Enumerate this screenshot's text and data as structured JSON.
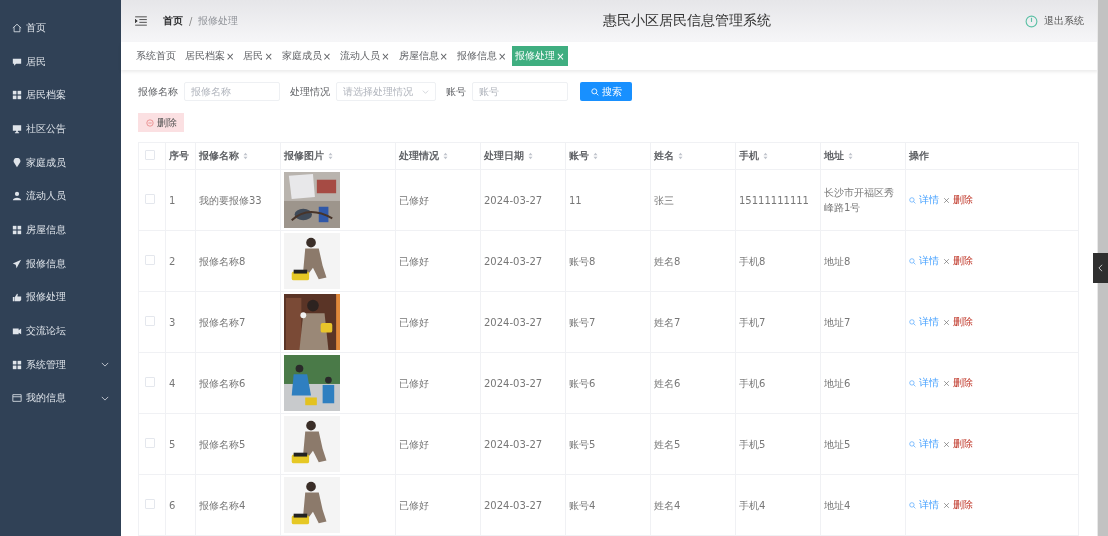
{
  "sidebar": {
    "items": [
      {
        "label": "首页",
        "expandable": false
      },
      {
        "label": "居民",
        "expandable": false
      },
      {
        "label": "居民档案",
        "expandable": false
      },
      {
        "label": "社区公告",
        "expandable": false
      },
      {
        "label": "家庭成员",
        "expandable": false
      },
      {
        "label": "流动人员",
        "expandable": false
      },
      {
        "label": "房屋信息",
        "expandable": false
      },
      {
        "label": "报修信息",
        "expandable": false
      },
      {
        "label": "报修处理",
        "expandable": false
      },
      {
        "label": "交流论坛",
        "expandable": false
      },
      {
        "label": "系统管理",
        "expandable": true
      },
      {
        "label": "我的信息",
        "expandable": true
      }
    ]
  },
  "header": {
    "breadcrumb": [
      "首页",
      "报修处理"
    ],
    "breadcrumb_separator": "/",
    "title": "惠民小区居民信息管理系统",
    "logout": "退出系统"
  },
  "tabs": [
    {
      "label": "系统首页",
      "closable": false,
      "selected": false
    },
    {
      "label": "居民档案",
      "closable": true,
      "selected": false
    },
    {
      "label": "居民",
      "closable": true,
      "selected": false
    },
    {
      "label": "家庭成员",
      "closable": true,
      "selected": false
    },
    {
      "label": "流动人员",
      "closable": true,
      "selected": false
    },
    {
      "label": "房屋信息",
      "closable": true,
      "selected": false
    },
    {
      "label": "报修信息",
      "closable": true,
      "selected": false
    },
    {
      "label": "报修处理",
      "closable": true,
      "selected": true
    }
  ],
  "close_mark": "×",
  "search": {
    "fields": [
      {
        "label": "报修名称",
        "placeholder": "报修名称",
        "kind": "text"
      },
      {
        "label": "处理情况",
        "placeholder": "请选择处理情况",
        "kind": "select"
      },
      {
        "label": "账号",
        "placeholder": "账号",
        "kind": "text"
      }
    ],
    "button": "搜索"
  },
  "delete_button": "删除",
  "table": {
    "columns": [
      {
        "label": "序号",
        "sortable": false
      },
      {
        "label": "报修名称",
        "sortable": true
      },
      {
        "label": "报修图片",
        "sortable": true
      },
      {
        "label": "处理情况",
        "sortable": true
      },
      {
        "label": "处理日期",
        "sortable": true
      },
      {
        "label": "账号",
        "sortable": true
      },
      {
        "label": "姓名",
        "sortable": true
      },
      {
        "label": "手机",
        "sortable": true
      },
      {
        "label": "地址",
        "sortable": true
      },
      {
        "label": "操作",
        "sortable": false
      }
    ],
    "select_all_checked": false,
    "rows": [
      {
        "checked": false,
        "before": [
          "1",
          "我的要报修33"
        ],
        "after": [
          "已修好",
          "2024-03-27",
          "11",
          "张三",
          "15111111111",
          "长沙市开福区秀峰路1号"
        ],
        "actions": [
          "详情",
          "删除"
        ]
      },
      {
        "checked": false,
        "before": [
          "2",
          "报修名称8"
        ],
        "after": [
          "已修好",
          "2024-03-27",
          "账号8",
          "姓名8",
          "手机8",
          "地址8"
        ],
        "actions": [
          "详情",
          "删除"
        ]
      },
      {
        "checked": false,
        "before": [
          "3",
          "报修名称7"
        ],
        "after": [
          "已修好",
          "2024-03-27",
          "账号7",
          "姓名7",
          "手机7",
          "地址7"
        ],
        "actions": [
          "详情",
          "删除"
        ]
      },
      {
        "checked": false,
        "before": [
          "4",
          "报修名称6"
        ],
        "after": [
          "已修好",
          "2024-03-27",
          "账号6",
          "姓名6",
          "手机6",
          "地址6"
        ],
        "actions": [
          "详情",
          "删除"
        ]
      },
      {
        "checked": false,
        "before": [
          "5",
          "报修名称5"
        ],
        "after": [
          "已修好",
          "2024-03-27",
          "账号5",
          "姓名5",
          "手机5",
          "地址5"
        ],
        "actions": [
          "详情",
          "删除"
        ]
      },
      {
        "checked": false,
        "before": [
          "6",
          "报修名称4"
        ],
        "after": [
          "已修好",
          "2024-03-27",
          "账号4",
          "姓名4",
          "手机4",
          "地址4"
        ],
        "actions": [
          "详情",
          "删除"
        ]
      }
    ]
  }
}
